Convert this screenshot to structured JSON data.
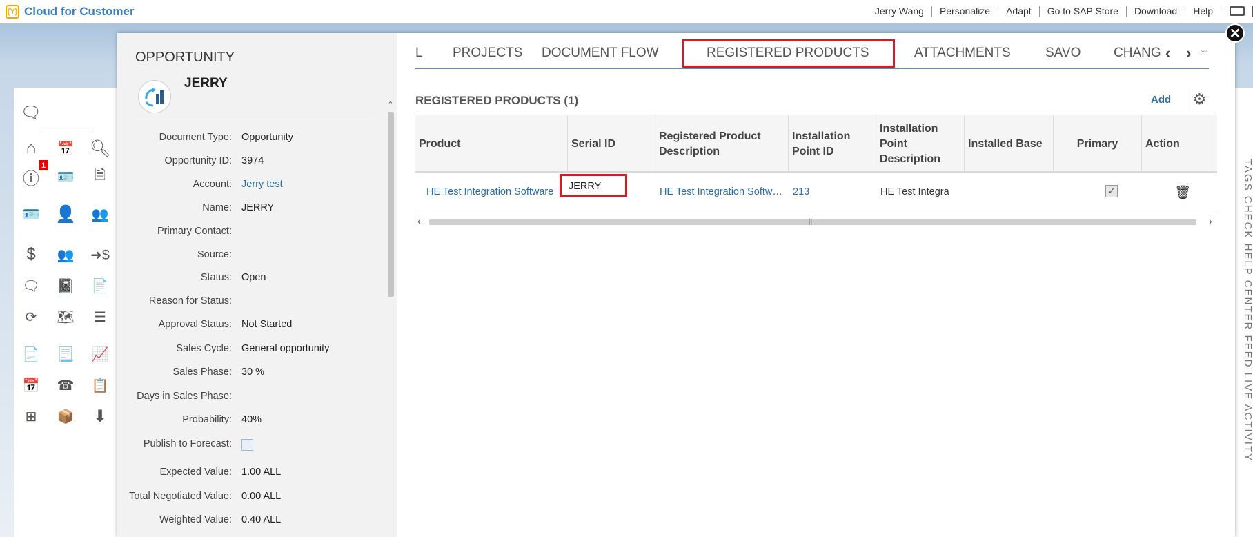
{
  "app": {
    "title": "Cloud for Customer",
    "logo_letter": "(Y)"
  },
  "toplinks": [
    "Jerry Wang",
    "Personalize",
    "Adapt",
    "Go to SAP Store",
    "Download",
    "Help"
  ],
  "launchpad": {
    "notification_count": "1"
  },
  "close_label": "✕",
  "object": {
    "type": "OPPORTUNITY",
    "name": "JERRY",
    "fields": [
      {
        "label": "Document Type:",
        "value": "Opportunity"
      },
      {
        "label": "Opportunity ID:",
        "value": "3974"
      },
      {
        "label": "Account:",
        "value": "Jerry test",
        "link": true
      },
      {
        "label": "Name:",
        "value": "JERRY"
      },
      {
        "label": "Primary Contact:",
        "value": ""
      },
      {
        "label": "Source:",
        "value": ""
      },
      {
        "label": "Status:",
        "value": "Open"
      },
      {
        "label": "Reason for Status:",
        "value": ""
      },
      {
        "label": "Approval Status:",
        "value": "Not Started"
      },
      {
        "label": "Sales Cycle:",
        "value": "General opportunity"
      },
      {
        "label": "Sales Phase:",
        "value": "30 %"
      },
      {
        "label": "Days in Sales Phase:",
        "value": ""
      },
      {
        "label": "Probability:",
        "value": "40%"
      },
      {
        "label": "Publish to Forecast:",
        "checkbox": true,
        "checked": false
      },
      {
        "label": "Expected Value:",
        "value": "1.00 ALL"
      },
      {
        "label": "Total Negotiated Value:",
        "value": "0.00 ALL"
      },
      {
        "label": "Weighted Value:",
        "value": "0.40 ALL"
      }
    ]
  },
  "tabs": {
    "items": [
      "L",
      "PROJECTS",
      "DOCUMENT FLOW",
      "REGISTERED PRODUCTS",
      "ATTACHMENTS",
      "SAVO",
      "CHANG"
    ],
    "selected": "REGISTERED PRODUCTS",
    "prev": "‹",
    "next": "›",
    "more": "◦◦◦"
  },
  "section": {
    "title": "REGISTERED PRODUCTS (1)",
    "add_label": "Add"
  },
  "table": {
    "columns": [
      "Product",
      "Serial ID",
      "Registered Product Description",
      "Installation Point ID",
      "Installation Point Description",
      "Installed Base",
      "Primary",
      "Action"
    ],
    "rows": [
      {
        "product": "HE Test Integration Software",
        "serial_id": "JERRY",
        "description": "HE Test Integration Softw…",
        "installation_point_id": "213",
        "installation_point_description": "HE Test Integra",
        "installed_base": "",
        "primary": true
      }
    ]
  },
  "side_vertical_text": "TAGS   CHECK   HELP CENTER   FEED   LIVE ACTIVITY"
}
